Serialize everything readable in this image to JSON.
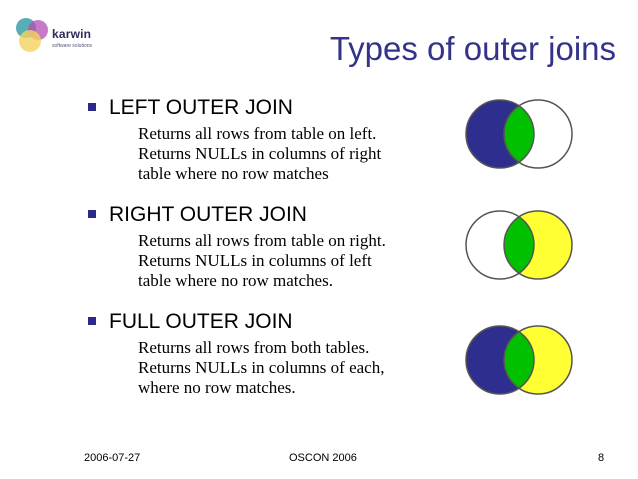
{
  "logo": {
    "name": "karwin",
    "tagline": "software solutions"
  },
  "slide": {
    "title": "Types of outer joins",
    "items": [
      {
        "heading": "LEFT OUTER JOIN",
        "lines": [
          "Returns all rows from table on left.",
          "Returns NULLs in columns of right",
          "table where no row matches"
        ],
        "venn": {
          "left_fill": "#2e2e8f",
          "overlap_fill": "#00c000",
          "right_fill": "#ffffff"
        }
      },
      {
        "heading": "RIGHT OUTER JOIN",
        "lines": [
          "Returns all rows from table on right.",
          "Returns NULLs in columns of left",
          "table where no row matches."
        ],
        "venn": {
          "left_fill": "#ffffff",
          "overlap_fill": "#00c000",
          "right_fill": "#ffff33"
        }
      },
      {
        "heading": "FULL OUTER JOIN",
        "lines": [
          "Returns all rows from both tables.",
          "Returns NULLs in columns of each,",
          "where no row matches."
        ],
        "venn": {
          "left_fill": "#2e2e8f",
          "overlap_fill": "#00c000",
          "right_fill": "#ffff33"
        }
      }
    ]
  },
  "footer": {
    "date": "2006-07-27",
    "event": "OSCON 2006",
    "page": "8"
  },
  "colors": {
    "title": "#33338a",
    "bullet": "#2a2a8c",
    "venn_outline": "#555555"
  }
}
